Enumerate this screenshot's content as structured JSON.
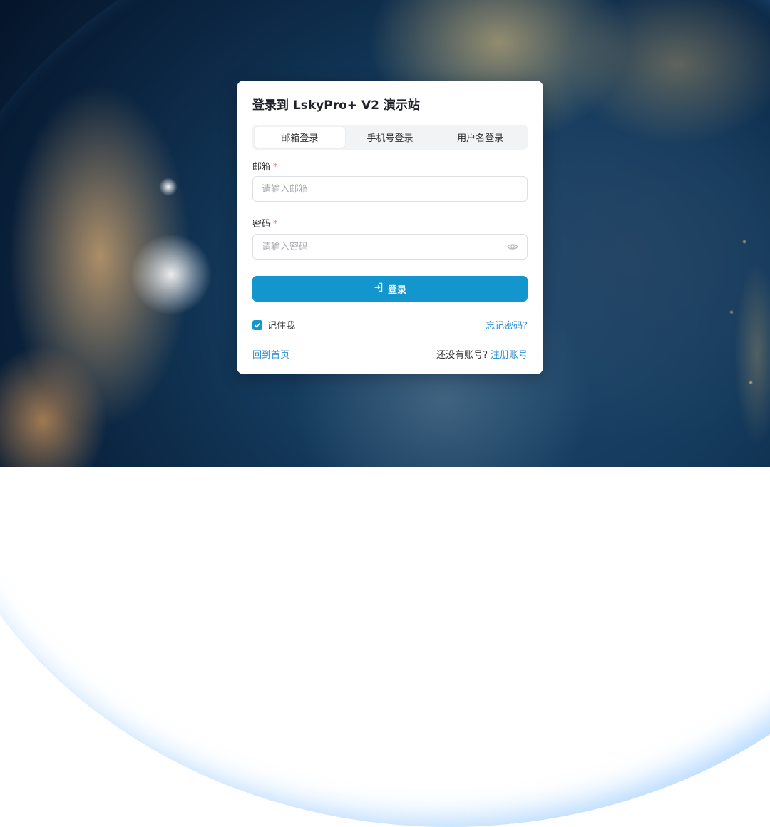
{
  "page": {
    "title": "登录到 LskyPro+ V2 演示站"
  },
  "tabs": [
    {
      "label": "邮箱登录",
      "active": true
    },
    {
      "label": "手机号登录",
      "active": false
    },
    {
      "label": "用户名登录",
      "active": false
    }
  ],
  "form": {
    "email_label": "邮箱",
    "email_placeholder": "请输入邮箱",
    "email_value": "",
    "password_label": "密码",
    "password_placeholder": "请输入密码",
    "password_value": "",
    "required_mark": "*",
    "submit_label": "登录",
    "remember_label": "记住我",
    "remember_checked": true,
    "forgot_label": "忘记密码?"
  },
  "footer": {
    "home_label": "回到首页",
    "no_account_text": "还没有账号?",
    "register_label": "注册账号"
  },
  "colors": {
    "primary": "#1296cd",
    "link": "#2d8fd0",
    "required": "#f56c6c"
  },
  "icons": {
    "password_toggle": "eye-icon",
    "submit": "login-icon",
    "checkbox": "check-icon"
  }
}
